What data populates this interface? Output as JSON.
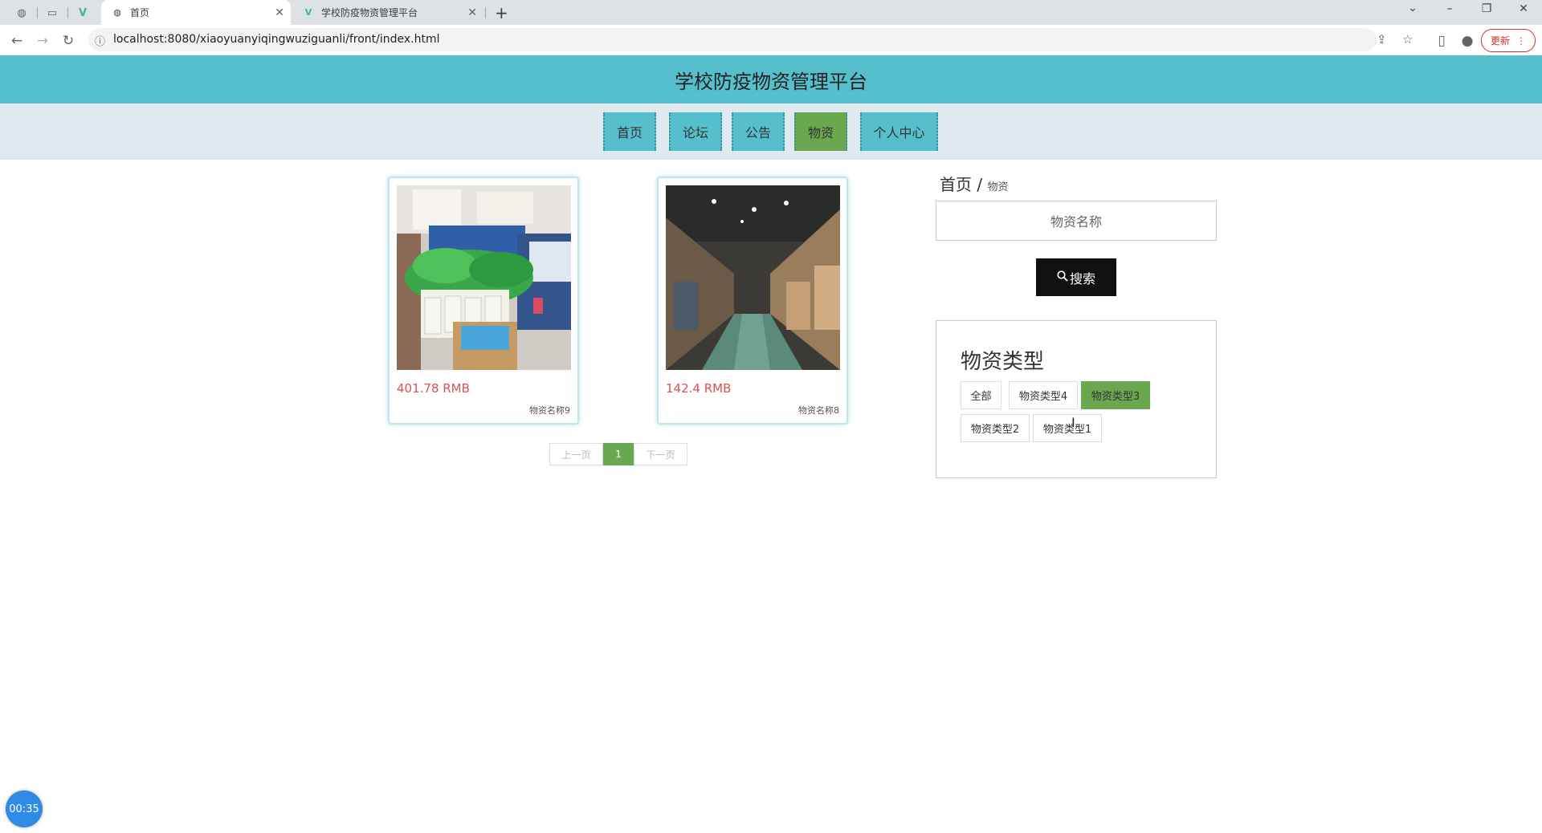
{
  "browser": {
    "tabs": [
      {
        "title": "首页",
        "icon": "globe-icon"
      },
      {
        "title": "学校防疫物资管理平台",
        "icon": "vue-logo-icon"
      }
    ],
    "url": "localhost:8080/xiaoyuanyiqingwuziguanli/front/index.html",
    "update_label": "更新"
  },
  "page": {
    "title": "学校防疫物资管理平台",
    "nav": [
      "首页",
      "论坛",
      "公告",
      "物资",
      "个人中心"
    ],
    "active_nav": "物资",
    "products": [
      {
        "price": "401.78 RMB",
        "name": "物资名称9"
      },
      {
        "price": "142.4 RMB",
        "name": "物资名称8"
      }
    ],
    "pager": {
      "prev": "上一页",
      "current": "1",
      "next": "下一页"
    },
    "breadcrumb": {
      "home": "首页",
      "sep": "/",
      "current": "物资"
    },
    "search": {
      "placeholder": "物资名称",
      "button": "搜索"
    },
    "categories": {
      "title": "物资类型",
      "items": [
        "全部",
        "物资类型4",
        "物资类型3",
        "物资类型2",
        "物资类型1"
      ],
      "active": "物资类型3"
    },
    "timer": "00:35",
    "colors": {
      "header": "#56bfcd",
      "nav_bg": "#dfe9ef",
      "active": "#6aa84f",
      "price": "#d9534f"
    }
  }
}
